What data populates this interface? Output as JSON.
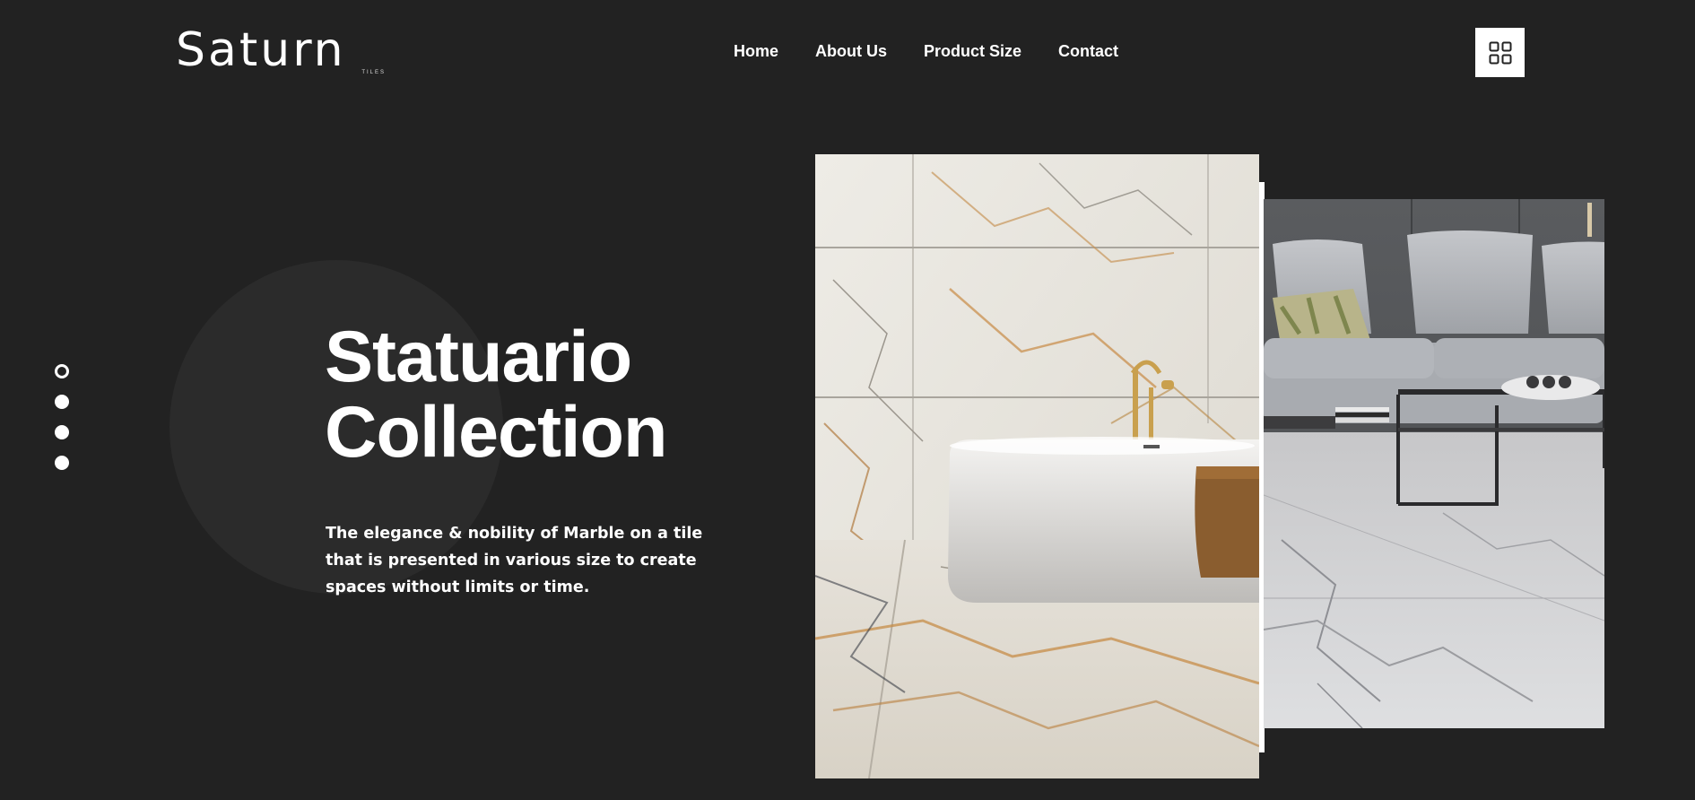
{
  "brand": {
    "name": "Saturn",
    "sub": "TILES"
  },
  "nav": {
    "items": [
      "Home",
      "About Us",
      "Product Size",
      "Contact"
    ]
  },
  "menu_button": {
    "icon": "grid-icon"
  },
  "slider": {
    "count": 4,
    "active_index": 0
  },
  "hero": {
    "title_line1": "Statuario",
    "title_line2": "Collection",
    "description": "The elegance & nobility of Marble on a tile that is presented in various size to create spaces without limits or time."
  },
  "images": {
    "primary": "bathroom-marble-tub-photo",
    "secondary": "living-room-marble-floor-photo"
  },
  "colors": {
    "background": "#222222",
    "circle": "#2b2b2b",
    "text": "#ffffff"
  }
}
